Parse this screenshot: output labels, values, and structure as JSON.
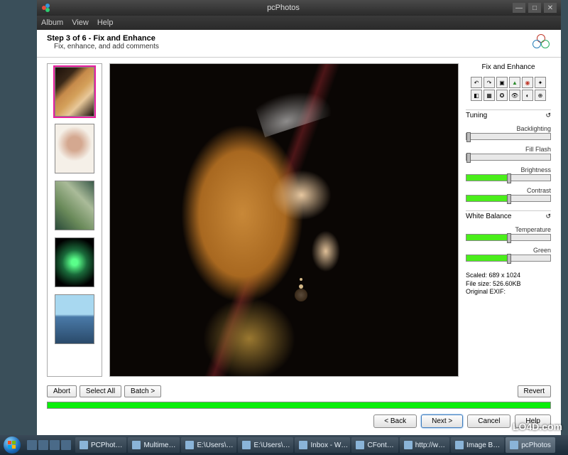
{
  "window": {
    "title": "pcPhotos",
    "menu": [
      "Album",
      "View",
      "Help"
    ]
  },
  "header": {
    "title": "Step 3 of 6 - Fix and Enhance",
    "subtitle": "Fix, enhance, and add comments"
  },
  "thumbs": [
    {
      "selected": true
    },
    {
      "selected": false
    },
    {
      "selected": false
    },
    {
      "selected": false
    },
    {
      "selected": false
    }
  ],
  "panel": {
    "title": "Fix and Enhance",
    "tuning_label": "Tuning",
    "sliders": {
      "backlighting": {
        "label": "Backlighting",
        "pct": 0
      },
      "fillflash": {
        "label": "Fill Flash",
        "pct": 0
      },
      "brightness": {
        "label": "Brightness",
        "pct": 48
      },
      "contrast": {
        "label": "Contrast",
        "pct": 48
      }
    },
    "whitebalance_label": "White Balance",
    "wb": {
      "temperature": {
        "label": "Temperature",
        "pct": 48
      },
      "green": {
        "label": "Green",
        "pct": 48
      }
    },
    "info": {
      "scaled": "Scaled: 689 x 1024",
      "filesize": "File size: 526.60KB",
      "exif": "Original EXIF:"
    }
  },
  "actions": {
    "abort": "Abort",
    "selectall": "Select All",
    "batch": "Batch >",
    "revert": "Revert"
  },
  "progress_pct": 100,
  "nav": {
    "back": "< Back",
    "next": "Next >",
    "cancel": "Cancel",
    "help": "Help"
  },
  "taskbar": {
    "items": [
      "PCPhot…",
      "Multime…",
      "E:\\Users\\…",
      "E:\\Users\\…",
      "Inbox - W…",
      "CFont…",
      "http://w…",
      "Image B…",
      "pcPhotos"
    ]
  },
  "watermark": "LO4D.com"
}
